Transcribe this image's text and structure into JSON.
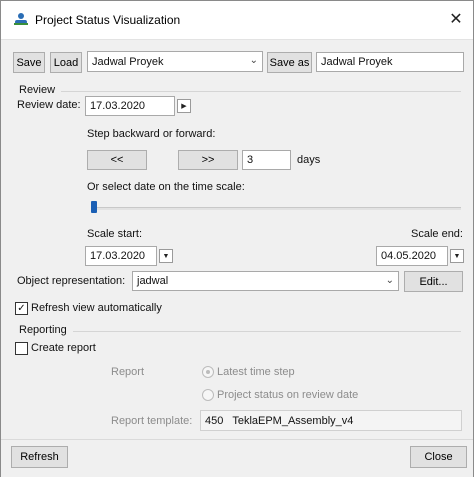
{
  "window": {
    "title": "Project Status Visualization"
  },
  "toolbar": {
    "save_label": "Save",
    "load_label": "Load",
    "settings_value": "Jadwal Proyek",
    "save_as_label": "Save as",
    "save_as_value": "Jadwal Proyek"
  },
  "review": {
    "group_label": "Review",
    "date_label": "Review date:",
    "date_value": "17.03.2020",
    "step_label": "Step backward or forward:",
    "back_label": "<<",
    "forward_label": ">>",
    "step_value": "3",
    "days_label": "days",
    "scale_label": "Or select date on the time scale:",
    "slider_fraction": 0.0,
    "scale_start_label": "Scale start:",
    "scale_start_value": "17.03.2020",
    "scale_end_label": "Scale end:",
    "scale_end_value": "04.05.2020",
    "object_rep_label": "Object representation:",
    "object_rep_value": "jadwal",
    "edit_label": "Edit...",
    "refresh_auto_label": "Refresh view automatically",
    "refresh_auto_checked": true
  },
  "reporting": {
    "group_label": "Reporting",
    "create_report_label": "Create report",
    "create_report_checked": false,
    "report_label": "Report",
    "latest_step_label": "Latest time step",
    "project_status_label": "Project status on review date",
    "template_label": "Report template:",
    "template_value": "450   TeklaEPM_Assembly_v4"
  },
  "footer": {
    "refresh_label": "Refresh",
    "close_label": "Close"
  },
  "colors": {
    "slider_thumb": "#1a5fb4",
    "window_bg": "#f0f0f0"
  }
}
